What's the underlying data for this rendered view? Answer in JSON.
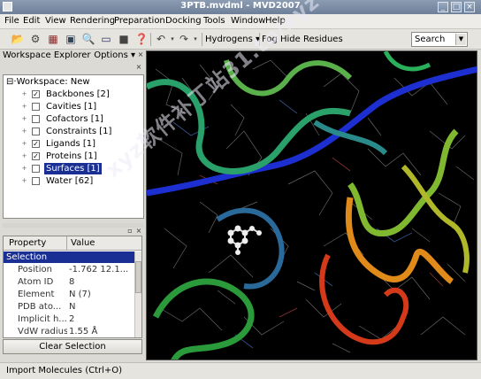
{
  "window": {
    "title": "3PTB.mvdml - MVD2007",
    "controls": [
      "_",
      "□",
      "×"
    ]
  },
  "menu": [
    "File",
    "Edit",
    "View",
    "Rendering",
    "Preparation",
    "Docking",
    "Tools",
    "Window",
    "Help"
  ],
  "toolbar": {
    "icons": [
      "open-icon",
      "settings-icon",
      "import-icon",
      "save-icon",
      "find-icon",
      "monitor-icon",
      "camera-icon",
      "help-icon",
      "undo-icon",
      "redo-icon"
    ],
    "hydrogens_label": "Hydrogens ▾",
    "fog_label": "Fog",
    "hide_residues_label": "Hide Residues",
    "search_value": "Search"
  },
  "workspace": {
    "title": "Workspace Explorer",
    "options_label": "Options ▾",
    "root": "Workspace: New",
    "items": [
      {
        "label": "Backbones [2]",
        "checked": true
      },
      {
        "label": "Cavities [1]",
        "checked": false
      },
      {
        "label": "Cofactors [1]",
        "checked": false
      },
      {
        "label": "Constraints [1]",
        "checked": false
      },
      {
        "label": "Ligands [1]",
        "checked": true
      },
      {
        "label": "Proteins [1]",
        "checked": true
      },
      {
        "label": "Surfaces [1]",
        "checked": false
      },
      {
        "label": "Water [62]",
        "checked": false
      }
    ]
  },
  "properties": {
    "col_property": "Property",
    "col_value": "Value",
    "selection_label": "Selection",
    "rows": [
      {
        "key": "Position",
        "value": "-1.762 12.1..."
      },
      {
        "key": "Atom ID",
        "value": "8"
      },
      {
        "key": "Element",
        "value": "N (7)"
      },
      {
        "key": "PDB ato...",
        "value": "N"
      },
      {
        "key": "Implicit h...",
        "value": "2"
      },
      {
        "key": "VdW radius",
        "value": "1.55 Å"
      }
    ],
    "clear_button": "Clear Selection"
  },
  "status": "Import Molecules (Ctrl+O)",
  "watermark": "xyz软件补丁站31.to/xyz",
  "colors": {
    "selection": "#1a2f94",
    "viewport_bg": "#000000"
  }
}
